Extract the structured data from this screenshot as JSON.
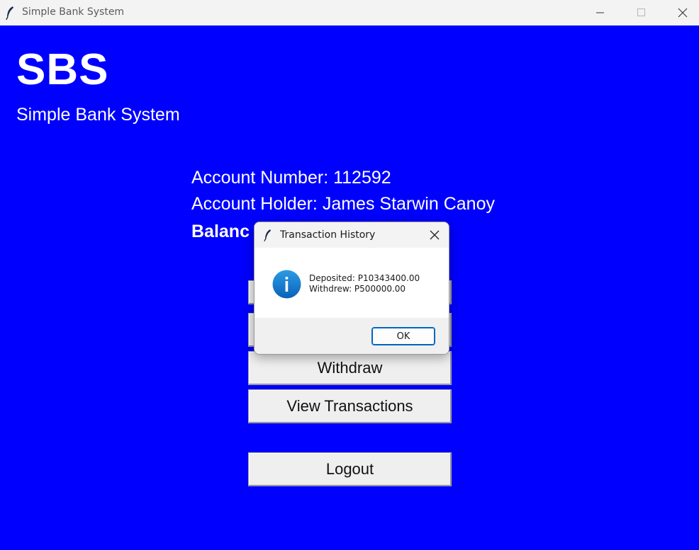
{
  "window": {
    "title": "Simple Bank System",
    "icon": "feather-icon"
  },
  "header": {
    "logo": "SBS",
    "subtitle": "Simple Bank System"
  },
  "account": {
    "number_line": "Account Number: 112592",
    "holder_line": "Account Holder: James Starwin Canoy",
    "balance_line": "Balanc"
  },
  "buttons": {
    "withdraw": "Withdraw",
    "view_transactions": "View Transactions",
    "logout": "Logout"
  },
  "dialog": {
    "title": "Transaction History",
    "icon": "info-icon",
    "line1": "Deposited: P10343400.00",
    "line2": "Withdrew: P500000.00",
    "ok_label": "OK"
  },
  "colors": {
    "background": "#0000ff",
    "text": "#ffffff",
    "accent": "#0067c0"
  }
}
